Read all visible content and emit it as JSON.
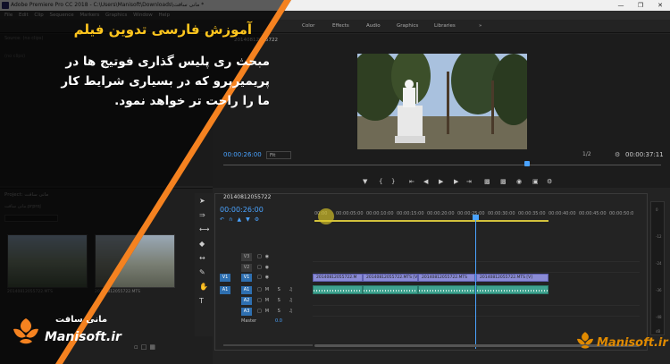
{
  "window": {
    "title": "Adobe Premiere Pro CC 2018 - C:\\Users\\Manisoft\\Downloads\\مانی سافت *"
  },
  "menu": [
    "File",
    "Edit",
    "Clip",
    "Sequence",
    "Markers",
    "Graphics",
    "Window",
    "Help"
  ],
  "workspaces": [
    "Color",
    "Effects",
    "Audio",
    "Graphics",
    "Libraries"
  ],
  "workspaces_more": "»",
  "source_panel": {
    "tab": "Source: (no clips)",
    "sub": "(no clips)"
  },
  "project_panel": {
    "tab": "Project: مانی سافت",
    "breadcrumb": "مانی سافت.prproj",
    "thumbnails": [
      {
        "label": "20140812055722.MTS"
      },
      {
        "label": "20140812055722.MTS"
      }
    ]
  },
  "banner": {
    "title": "آموزش فارسی تدوین فیلم",
    "lines": [
      "مبحث ری پلیس گذاری فوتیج ها در",
      "پریمیرپرو که در بسیاری شرایط کار",
      "ما را راحت تر خواهد نمود."
    ],
    "accent": "#f58220"
  },
  "logo": {
    "fa": "مانی سافت",
    "en": "Manisoft.ir"
  },
  "program": {
    "sequence_tab": "20140812055722",
    "timecode_current": "00:00:26:00",
    "fit": "Fit",
    "resolution": "1/2",
    "timecode_duration": "00:00:37:11"
  },
  "timeline": {
    "tab": "20140812055722",
    "timecode": "00:00:26:00",
    "ruler": [
      "00:00",
      "00:00:05:00",
      "00:00:10:00",
      "00:00:15:00",
      "00:00:20:00",
      "00:00:25:00",
      "00:00:30:00",
      "00:00:35:00",
      "00:00:40:00",
      "00:00:45:00",
      "00:00:50:0"
    ],
    "video_tracks": [
      "V3",
      "V2",
      "V1"
    ],
    "audio_tracks": [
      "A1",
      "A2",
      "A3"
    ],
    "source_patch_video": "V1",
    "source_patch_audio": "A1",
    "master_label": "Master",
    "master_value": "0.0",
    "clips": [
      "20140812055722.M",
      "20140812055722.MTS [V]",
      "20140812055722.MTS",
      "20140812055722.MTS [V]"
    ]
  },
  "meter_labels": [
    "0",
    "-12",
    "-24",
    "-36",
    "-48",
    "dB"
  ],
  "tools_icons": [
    "selection-tool-icon",
    "track-select-tool-icon",
    "ripple-edit-tool-icon",
    "razor-tool-icon",
    "slip-tool-icon",
    "pen-tool-icon",
    "hand-tool-icon",
    "type-tool-icon"
  ],
  "brand_colors": {
    "accent_orange": "#f58220",
    "title_yellow": "#ffc61e",
    "premiere_blue": "#4aa3ff"
  }
}
